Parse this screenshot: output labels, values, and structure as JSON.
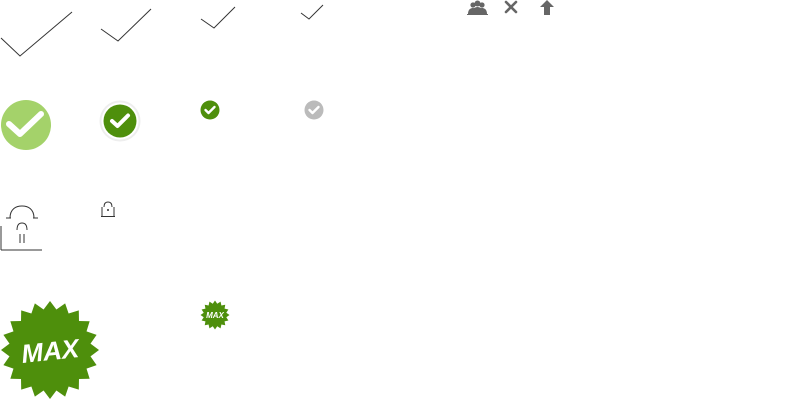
{
  "badges": {
    "max_large": "MAX",
    "max_small": "MAX"
  },
  "colors": {
    "check_line": "#333333",
    "check_circle_light": "#a4d26a",
    "check_circle_dark": "#4e8f0c",
    "check_circle_gray": "#bbbbbb",
    "lock_line": "#333333",
    "toolbar_icon": "#666666",
    "max_badge": "#4e8f0c"
  },
  "icons": [
    "checkmark-outline-icon",
    "checkmark-circle-icon",
    "lock-icon",
    "max-badge-icon",
    "users-icon",
    "close-icon",
    "upload-arrow-icon"
  ]
}
